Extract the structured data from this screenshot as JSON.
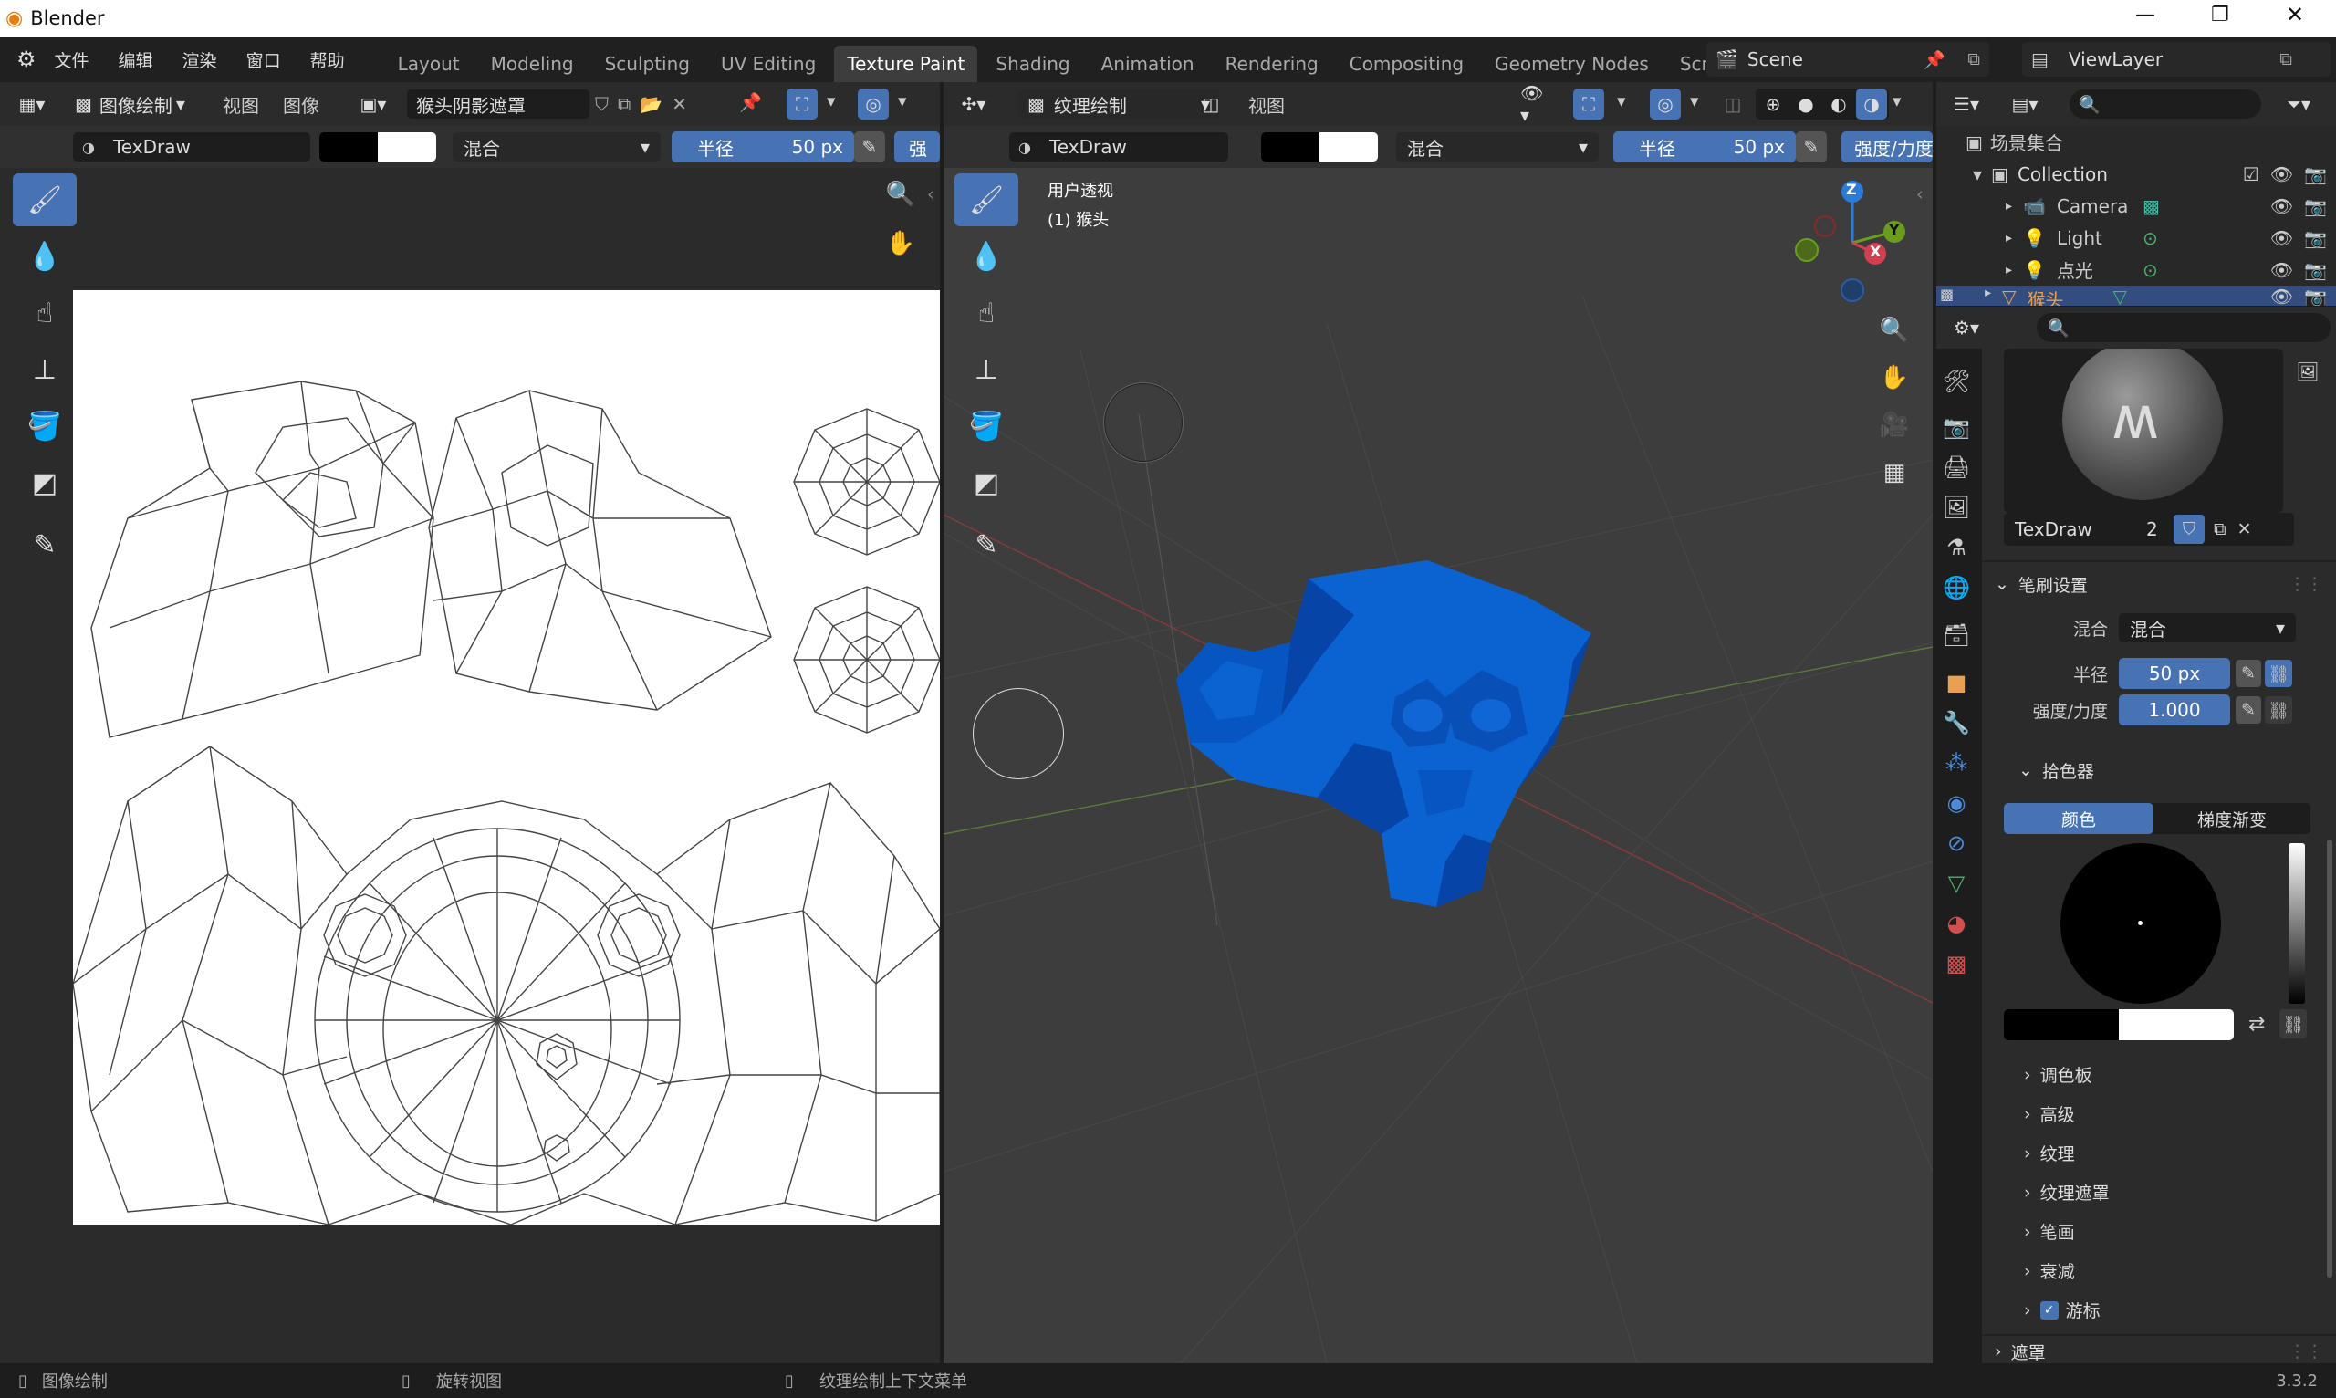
{
  "app": {
    "title": "Blender"
  },
  "menu": [
    "文件",
    "编辑",
    "渲染",
    "窗口",
    "帮助"
  ],
  "workspaces": [
    {
      "label": "Layout",
      "active": false
    },
    {
      "label": "Modeling",
      "active": false
    },
    {
      "label": "Sculpting",
      "active": false
    },
    {
      "label": "UV Editing",
      "active": false
    },
    {
      "label": "Texture Paint",
      "active": true
    },
    {
      "label": "Shading",
      "active": false
    },
    {
      "label": "Animation",
      "active": false
    },
    {
      "label": "Rendering",
      "active": false
    },
    {
      "label": "Compositing",
      "active": false
    },
    {
      "label": "Geometry Nodes",
      "active": false
    },
    {
      "label": "Scripting",
      "active": false
    }
  ],
  "scene": {
    "name": "Scene"
  },
  "view_layer": {
    "name": "ViewLayer"
  },
  "image_editor": {
    "mode": "图像绘制",
    "menu_view": "视图",
    "menu_image": "图像",
    "image_name": "猴头阴影遮罩",
    "brush_name": "TexDraw",
    "blend": "混合",
    "radius_label": "半径",
    "radius_value": "50 px",
    "strength_cut": "强"
  },
  "viewport": {
    "mode": "纹理绘制",
    "menu_view": "视图",
    "brush_name": "TexDraw",
    "blend": "混合",
    "radius_label": "半径",
    "radius_value": "50 px",
    "strength_cut": "强度/力度",
    "overlay_line1": "用户透视",
    "overlay_line2": "(1) 猴头",
    "axis": {
      "x": "X",
      "y": "Y",
      "z": "Z"
    }
  },
  "outliner": {
    "root": "场景集合",
    "collection": "Collection",
    "items": [
      {
        "label": "Camera"
      },
      {
        "label": "Light"
      },
      {
        "label": "点光"
      },
      {
        "label": "猴头"
      }
    ]
  },
  "properties": {
    "brush_name": "TexDraw",
    "brush_users": "2",
    "brush_settings": "笔刷设置",
    "blend_label": "混合",
    "blend_value": "混合",
    "radius_label": "半径",
    "radius_value": "50 px",
    "strength_label": "强度/力度",
    "strength_value": "1.000",
    "color_picker": "拾色器",
    "tab_color": "颜色",
    "tab_gradient": "梯度渐变",
    "subpanels": [
      "调色板",
      "高级",
      "纹理",
      "纹理遮罩",
      "笔画",
      "衰减",
      "游标"
    ],
    "mask": "遮罩"
  },
  "statusbar": {
    "left": "图像绘制",
    "mid": "旋转视图",
    "right": "纹理绘制上下文菜单",
    "version": "3.3.2"
  },
  "colors": {
    "accent": "#4772b3",
    "monkey": "#0a63d0",
    "monkey_dark": "#0644a8"
  }
}
